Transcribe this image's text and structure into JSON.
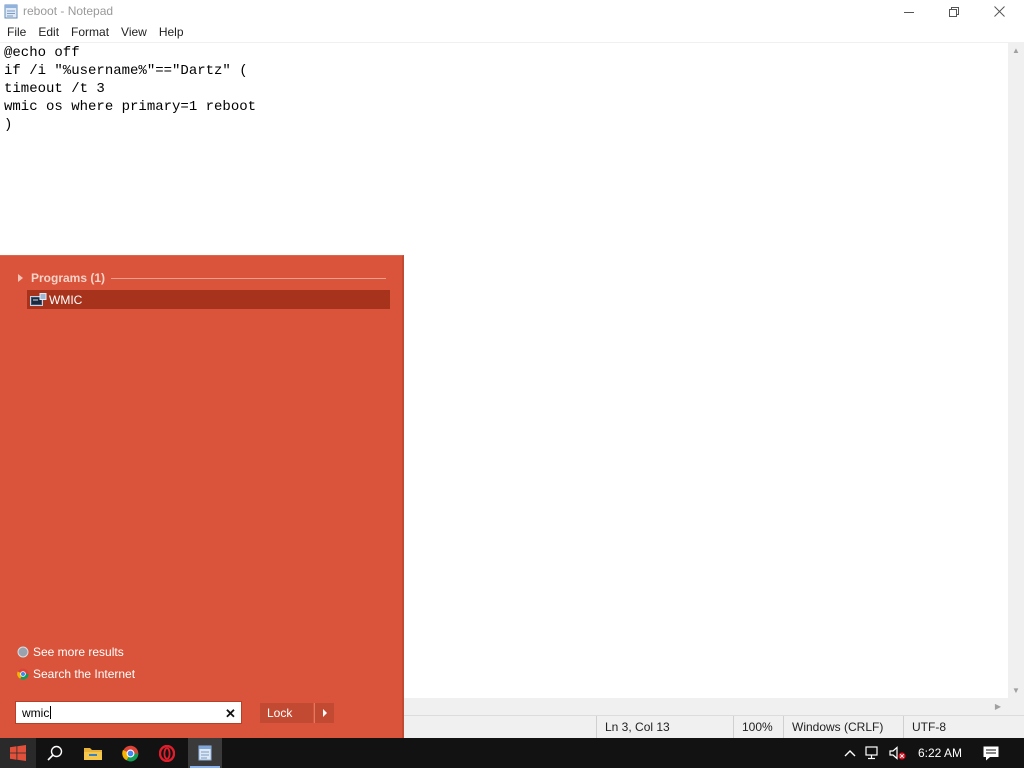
{
  "window": {
    "title": "reboot - Notepad",
    "icon": "notepad-icon",
    "minimize_icon": "minimize-icon",
    "restore_icon": "restore-icon",
    "close_icon": "close-icon"
  },
  "menu": {
    "items": [
      "File",
      "Edit",
      "Format",
      "View",
      "Help"
    ]
  },
  "editor": {
    "lines": [
      "@echo off",
      "if /i \"%username%\"==\"Dartz\" (",
      "timeout /t 3",
      "wmic os where primary=1 reboot",
      ")"
    ]
  },
  "statusbar": {
    "position": "Ln 3, Col 13",
    "zoom": "100%",
    "line_ending": "Windows (CRLF)",
    "encoding": "UTF-8"
  },
  "start_menu": {
    "group_label": "Programs (1)",
    "results": [
      {
        "label": "WMIC",
        "icon": "wmic-app-icon"
      }
    ],
    "see_more": "See more results",
    "search_internet": "Search the Internet",
    "search_value": "wmic",
    "clear_icon": "clear-icon",
    "lock_label": "Lock",
    "lock_arrow_icon": "chevron-right-icon",
    "colors": {
      "background": "#d9543a",
      "highlight": "#a8331d"
    }
  },
  "taskbar": {
    "items": [
      {
        "name": "start-button",
        "icon": "windows-logo-icon"
      },
      {
        "name": "search-button",
        "icon": "search-icon"
      },
      {
        "name": "file-explorer",
        "icon": "folder-icon"
      },
      {
        "name": "chrome",
        "icon": "chrome-icon"
      },
      {
        "name": "opera",
        "icon": "opera-icon"
      },
      {
        "name": "notepad",
        "icon": "notepad-icon"
      }
    ],
    "tray": {
      "overflow_icon": "chevron-up-icon",
      "network_icon": "network-icon",
      "volume_icon": "volume-muted-icon",
      "time": "6:22 AM",
      "notification_icon": "action-center-icon"
    }
  }
}
